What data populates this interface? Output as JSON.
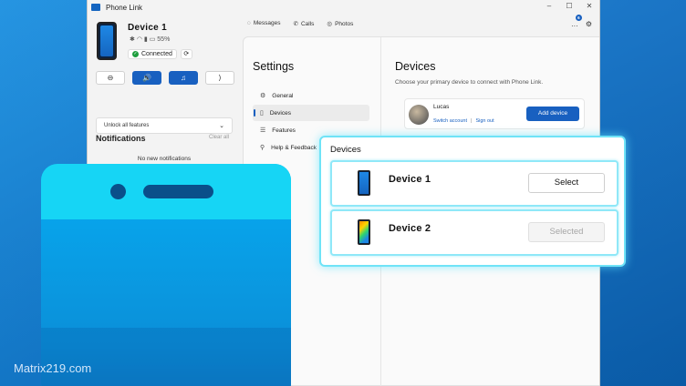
{
  "window": {
    "title": "Phone Link",
    "controls": [
      "–",
      "☐",
      "✕"
    ]
  },
  "device_panel": {
    "name": "Device 1",
    "battery": "55%",
    "connection": "Connected",
    "quick_actions": [
      "⊖",
      "🔊",
      "♫",
      "⟩"
    ]
  },
  "unlock": {
    "label": "Unlock all features"
  },
  "notifications": {
    "title": "Notifications",
    "clear": "Clear all",
    "empty": "No new notifications"
  },
  "nav": {
    "tabs": [
      "Messages",
      "Calls",
      "Photos"
    ],
    "notif_count": "6"
  },
  "settings": {
    "title": "Settings",
    "menu": [
      "General",
      "Devices",
      "Features",
      "Help & Feedback"
    ],
    "active": "Devices"
  },
  "devices": {
    "title": "Devices",
    "subtitle": "Choose your primary device to connect with Phone Link.",
    "account_name": "Lucas",
    "switch_account": "Switch account",
    "sign_out": "Sign out",
    "add_device": "Add device"
  },
  "picker": {
    "title": "Devices",
    "rows": [
      {
        "name": "Device 1",
        "button": "Select",
        "state": "enabled"
      },
      {
        "name": "Device 2",
        "button": "Selected",
        "state": "disabled"
      }
    ]
  },
  "watermark": "Matrix219.com",
  "colors": {
    "accent": "#1860c0",
    "highlight": "#6fe3f7",
    "phone_top": "#16d5f5",
    "phone_body": "#0aa0e8"
  }
}
